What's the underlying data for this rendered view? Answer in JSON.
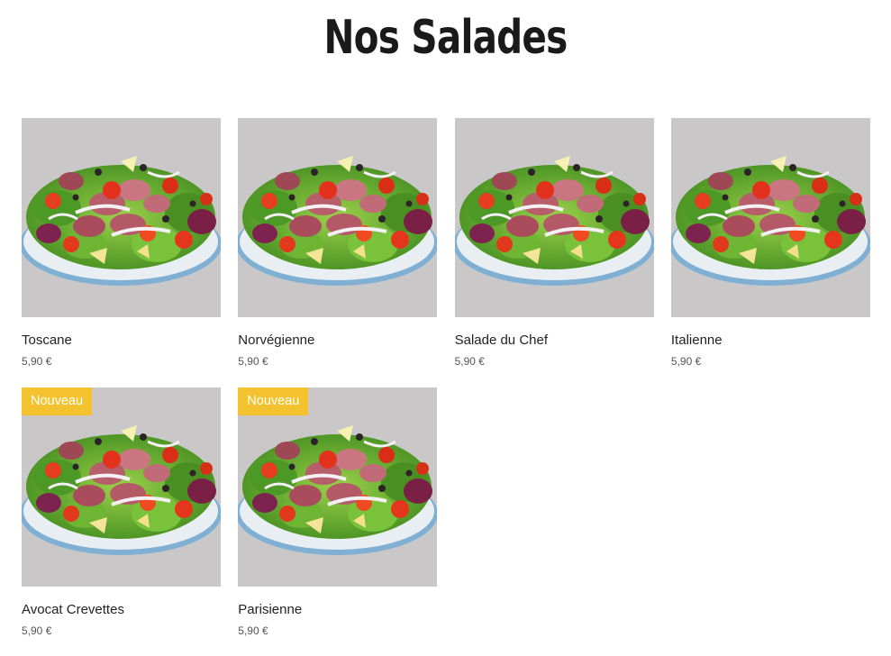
{
  "page": {
    "title": "Nos Salades"
  },
  "products": [
    {
      "name": "Toscane",
      "price": "5,90 €",
      "badge": ""
    },
    {
      "name": "Norvégienne",
      "price": "5,90 €",
      "badge": ""
    },
    {
      "name": "Salade du Chef",
      "price": "5,90 €",
      "badge": ""
    },
    {
      "name": "Italienne",
      "price": "5,90 €",
      "badge": ""
    },
    {
      "name": "Avocat Crevettes",
      "price": "5,90 €",
      "badge": "Nouveau"
    },
    {
      "name": "Parisienne",
      "price": "5,90 €",
      "badge": "Nouveau"
    }
  ],
  "colors": {
    "badge": "#f5c22f",
    "thumb_background": "#c9c7c8",
    "plate_rim": "#8fb9d6"
  },
  "icons": {
    "product_image": "salad-bowl-image"
  }
}
